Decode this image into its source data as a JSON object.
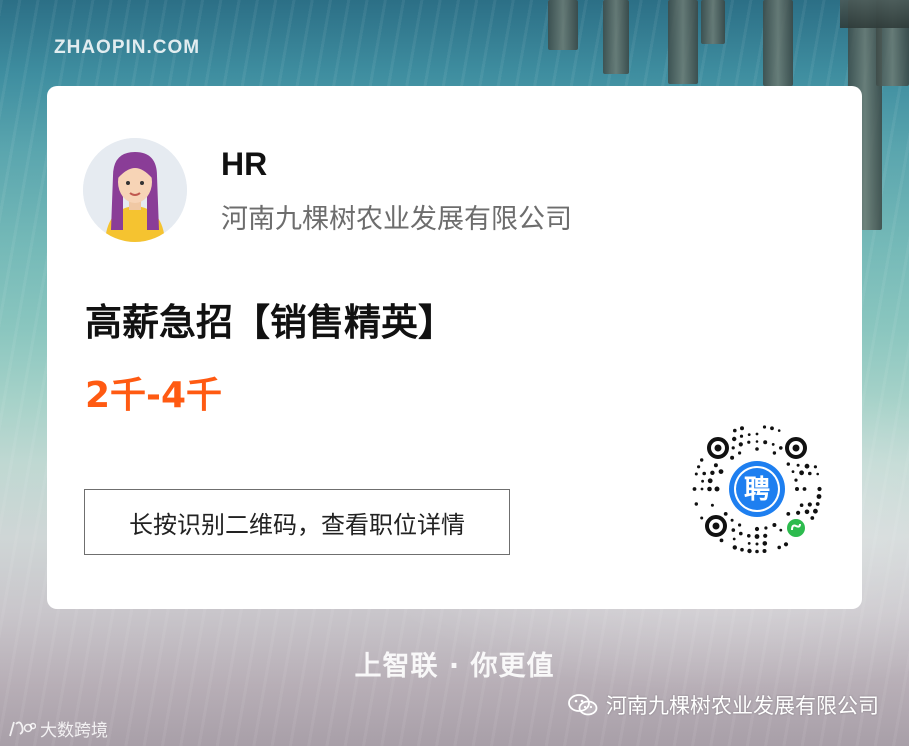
{
  "brand": {
    "logo_text": "ZHAOPIN.COM"
  },
  "card": {
    "hr_name": "HR",
    "company": "河南九棵树农业发展有限公司",
    "job_title": "高薪急招【销售精英】",
    "salary": "2千-4千",
    "scan_hint": "长按识别二维码，查看职位详情",
    "qr_center_char": "聘"
  },
  "slogan": "上智联 · 你更值",
  "footer": {
    "left_text": "大数跨境",
    "right_text": "河南九棵树农业发展有限公司"
  },
  "colors": {
    "salary": "#ff5a12",
    "qr_badge": "#1e7ff0",
    "mini_program": "#2dbb4e"
  },
  "icons": {
    "avatar": "hr-avatar-icon",
    "qr": "qr-code-icon",
    "wechat": "wechat-icon"
  }
}
